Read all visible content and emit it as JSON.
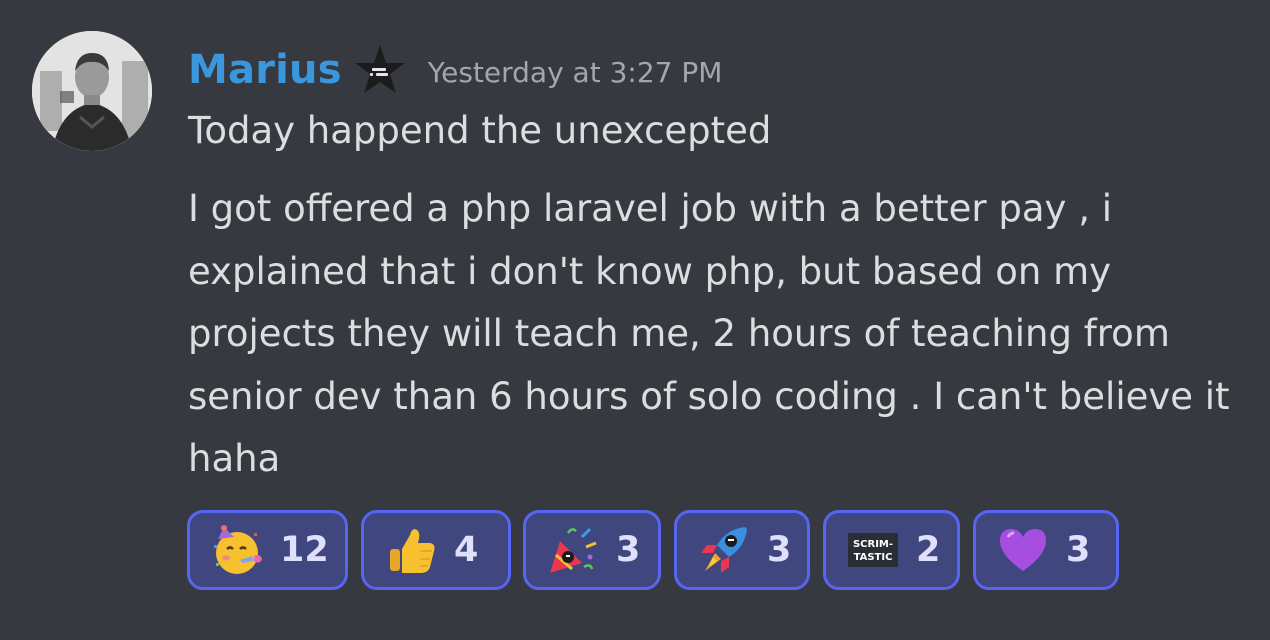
{
  "message": {
    "author": "Marius",
    "timestamp": "Yesterday at 3:27 PM",
    "lines": [
      "Today happend the unexcepted",
      "I got offered a php laravel job with a better pay , i explained that i don't know php, but based on my projects they will teach me, 2 hours of teaching from senior dev than 6 hours of solo coding . I can't believe it haha"
    ]
  },
  "icons": {
    "avatar": "user-avatar-photo",
    "role": "black-star-role-icon"
  },
  "reactions": [
    {
      "emoji": "partying-face",
      "count": "12"
    },
    {
      "emoji": "thumbs-up",
      "count": "4"
    },
    {
      "emoji": "party-popper-custom",
      "count": "3"
    },
    {
      "emoji": "rocket-custom",
      "count": "3"
    },
    {
      "emoji": "scrimtastic-custom",
      "label": "SCRIM-TASTIC",
      "count": "2"
    },
    {
      "emoji": "purple-heart",
      "count": "3"
    }
  ],
  "colors": {
    "background": "#36393f",
    "username": "#3b97dd",
    "text": "#dcddde",
    "reaction_border": "#5865f2",
    "reaction_bg": "#40467e"
  }
}
